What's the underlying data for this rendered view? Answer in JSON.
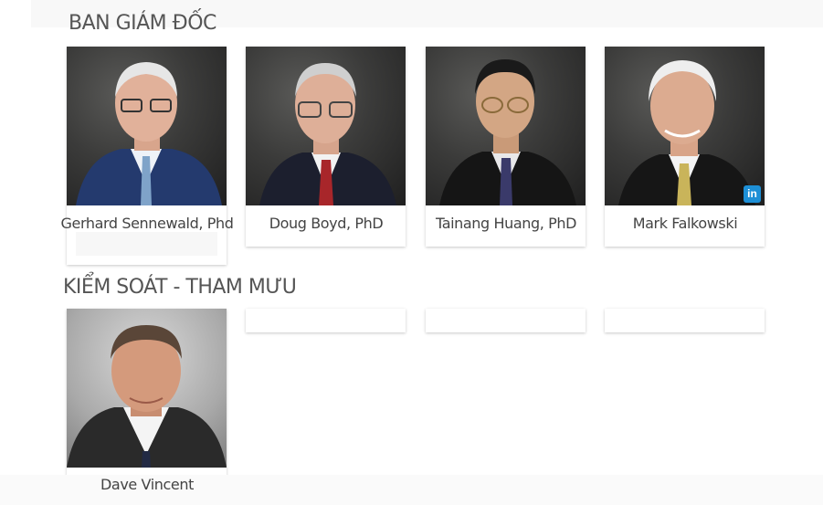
{
  "sections": [
    {
      "title": "BAN GIÁM ĐỐC",
      "people": [
        {
          "name": "Gerhard Sennewald, Phd",
          "tie_color": "#7fa3c9",
          "suit_color": "#243a6e",
          "hair_color": "#e6e6e6"
        },
        {
          "name": "Doug Boyd, PhD",
          "tie_color": "#a8262a",
          "suit_color": "#1c1f2e",
          "hair_color": "#cfcfcf"
        },
        {
          "name": "Tainang Huang, PhD",
          "tie_color": "#3a3a6a",
          "suit_color": "#151515",
          "hair_color": "#1a1a1a"
        },
        {
          "name": "Mark Falkowski",
          "tie_color": "#c9b45a",
          "suit_color": "#161616",
          "hair_color": "#eeeeee",
          "social": "in"
        }
      ]
    },
    {
      "title": "KIỂM SOÁT - THAM MƯU",
      "people": [
        {
          "name": "Dave Vincent",
          "tie_color": "#222a44",
          "suit_color": "#2a2a2a",
          "hair_color": "#5a4638"
        }
      ]
    }
  ]
}
